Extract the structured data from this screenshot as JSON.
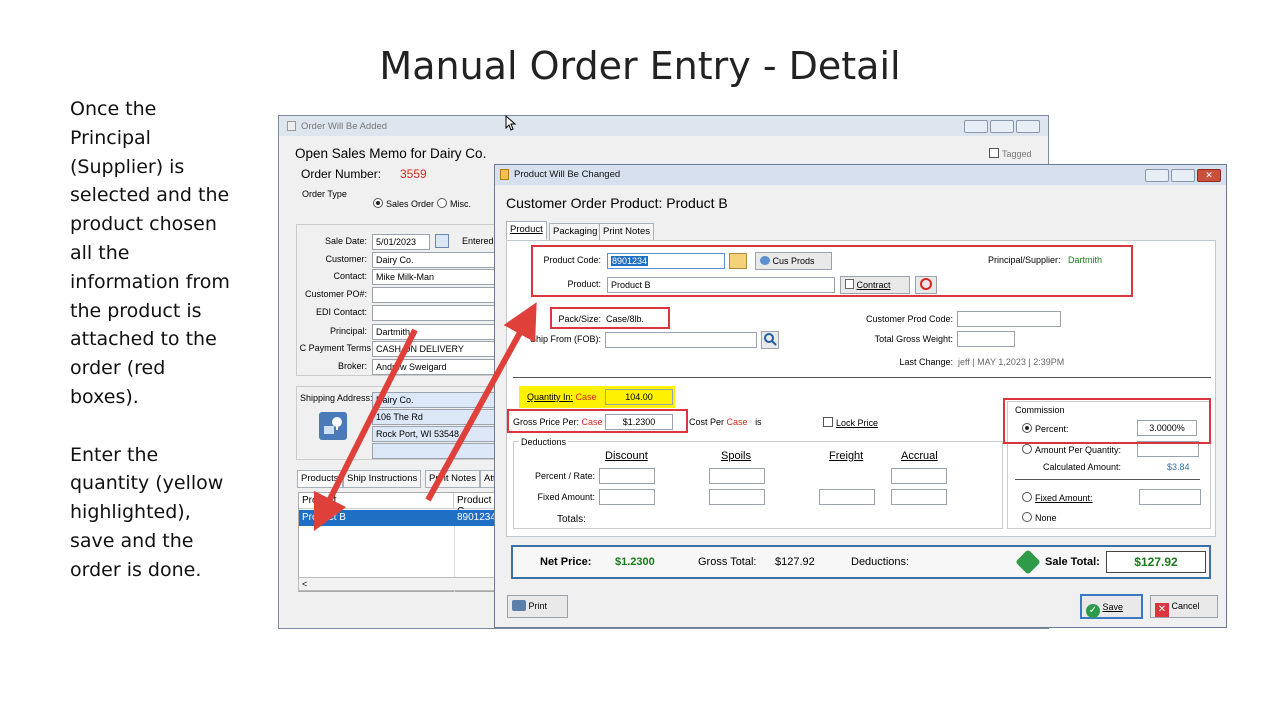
{
  "slide": {
    "title": "Manual Order Entry - Detail",
    "caption": [
      "Once the",
      "Principal",
      "(Supplier) is",
      "selected and the",
      "product chosen",
      "all the",
      "information from",
      "the product is",
      "attached to the",
      "order (red",
      "boxes).",
      "",
      "Enter the",
      "quantity (yellow",
      "highlighted),",
      "save and the",
      "order is done."
    ]
  },
  "back_window": {
    "title": "Order Will Be Added",
    "heading": "Open Sales Memo for Dairy Co.",
    "order_number_label": "Order Number:",
    "order_number": "3559",
    "tagged_label": "Tagged",
    "order_type_label": "Order Type",
    "order_type_sales": "Sales Order",
    "order_type_misc": "Misc.",
    "sale_date_label": "Sale Date:",
    "sale_date": "5/01/2023",
    "entered_label": "Entered I",
    "customer_label": "Customer:",
    "customer": "Dairy Co.",
    "contact_label": "Contact:",
    "contact": "Mike Milk-Man",
    "customer_po_label": "Customer PO#:",
    "edi_contact_label": "EDI Contact:",
    "principal_label": "Principal:",
    "principal": "Dartmith",
    "payment_terms_label": "C Payment Terms",
    "payment_terms": "CASH ON DELIVERY",
    "broker_label": "Broker:",
    "broker": "Andrew Sweigard",
    "shipping_address_label": "Shipping Address:",
    "ship_line1": "Dairy Co.",
    "ship_line2": "106 The Rd",
    "ship_line3": "Rock Port, WI 53548",
    "tabs": [
      "Products",
      "Ship Instructions",
      "Print Notes",
      "Att"
    ],
    "grid_headers": [
      "Product",
      "Product C"
    ],
    "grid_row": [
      "Product B",
      "8901234"
    ]
  },
  "front_window": {
    "title": "Product Will Be Changed",
    "heading": "Customer Order Product: Product B",
    "tabs": [
      "Product",
      "Packaging",
      "Print Notes"
    ],
    "product_code_label": "Product Code:",
    "product_code": "8901234",
    "cus_prods_label": "Cus Prods",
    "product_label": "Product:",
    "product": "Product B",
    "contract_label": "Contract",
    "principal_supplier_label": "Principal/Supplier:",
    "principal_supplier": "Dartmith",
    "pack_size_label": "Pack/Size:",
    "pack_size": "Case/8lb.",
    "ship_from_label": "Ship From (FOB):",
    "customer_prod_code_label": "Customer Prod Code:",
    "total_gross_weight_label": "Total Gross Weight:",
    "last_change_label": "Last Change:",
    "last_change": "jeff | MAY  1,2023 |  2:39PM",
    "quantity_in_label": "Quantity In:",
    "quantity_unit": "Case",
    "quantity": "104.00",
    "gross_price_per_label": "Gross Price Per:",
    "gross_price_unit": "Case",
    "gross_price": "$1.2300",
    "cost_per_label": "Cost Per",
    "cost_per_unit": "Case",
    "cost_per_is": "is",
    "lock_price_label": "Lock Price",
    "deductions_label": "Deductions",
    "deduction_columns": [
      "Discount",
      "Spoils",
      "Freight",
      "Accrual"
    ],
    "percent_rate_label": "Percent / Rate:",
    "fixed_amount_label": "Fixed Amount:",
    "totals_label": "Totals:",
    "commission_label": "Commission",
    "percent_label": "Percent:",
    "percent_value": "3.0000%",
    "amount_per_quantity_label": "Amount Per Quantity:",
    "calculated_amount_label": "Calculated Amount:",
    "calculated_amount": "$3.84",
    "commission_fixed_label": "Fixed Amount:",
    "none_label": "None",
    "net_price_label": "Net Price:",
    "net_price": "$1.2300",
    "gross_total_label": "Gross Total:",
    "gross_total": "$127.92",
    "deductions_total_label": "Deductions:",
    "sale_total_label": "Sale Total:",
    "sale_total": "$127.92",
    "print_label": "Print",
    "save_label": "Save",
    "cancel_label": "Cancel"
  },
  "colors": {
    "highlight_red": "#d9363e",
    "highlight_yellow": "#fff200",
    "selection_blue": "#1f6fc5",
    "green_text": "#1a7a1a"
  }
}
